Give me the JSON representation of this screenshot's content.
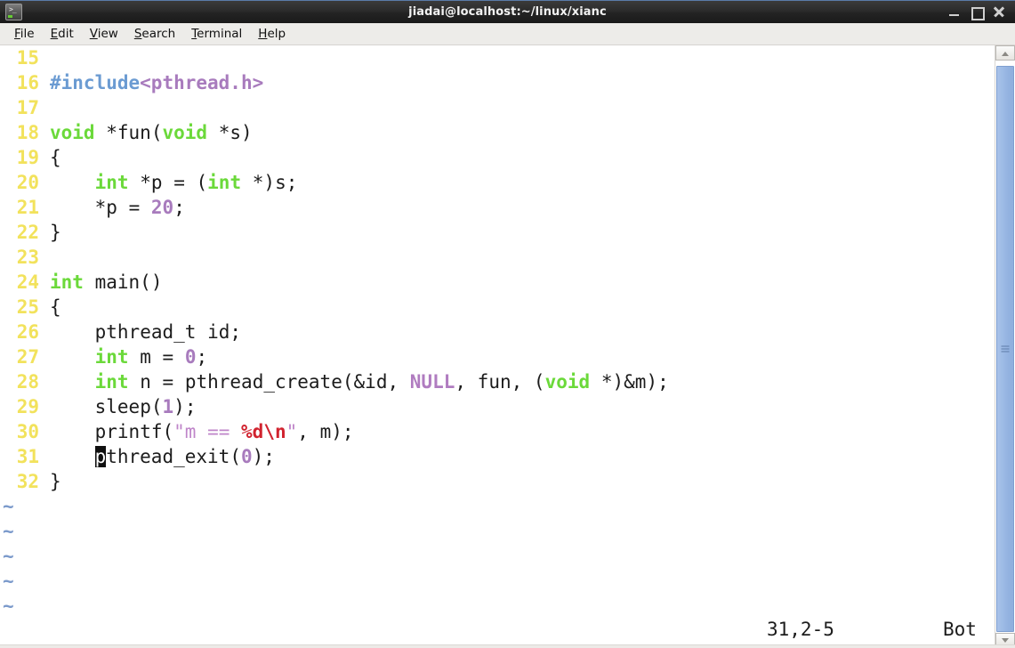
{
  "window": {
    "title": "jiadai@localhost:~/linux/xianc",
    "icon": "terminal-icon",
    "controls": {
      "minimize": "minimize-icon",
      "maximize": "maximize-icon",
      "close": "close-icon"
    }
  },
  "menubar": {
    "items": [
      {
        "label": "File",
        "mnemonic": "F"
      },
      {
        "label": "Edit",
        "mnemonic": "E"
      },
      {
        "label": "View",
        "mnemonic": "V"
      },
      {
        "label": "Search",
        "mnemonic": "S"
      },
      {
        "label": "Terminal",
        "mnemonic": "T"
      },
      {
        "label": "Help",
        "mnemonic": "H"
      }
    ]
  },
  "editor": {
    "lines": [
      {
        "num": "15",
        "text": ""
      },
      {
        "num": "16",
        "text": "#include<pthread.h>"
      },
      {
        "num": "17",
        "text": ""
      },
      {
        "num": "18",
        "text": "void *fun(void *s)"
      },
      {
        "num": "19",
        "text": "{"
      },
      {
        "num": "20",
        "text": "    int *p = (int *)s;"
      },
      {
        "num": "21",
        "text": "    *p = 20;"
      },
      {
        "num": "22",
        "text": "}"
      },
      {
        "num": "23",
        "text": ""
      },
      {
        "num": "24",
        "text": "int main()"
      },
      {
        "num": "25",
        "text": "{"
      },
      {
        "num": "26",
        "text": "    pthread_t id;"
      },
      {
        "num": "27",
        "text": "    int m = 0;"
      },
      {
        "num": "28",
        "text": "    int n = pthread_create(&id, NULL, fun, (void *)&m);"
      },
      {
        "num": "29",
        "text": "    sleep(1);"
      },
      {
        "num": "30",
        "text": "    printf(\"m == %d\\n\", m);"
      },
      {
        "num": "31",
        "text": "    pthread_exit(0);"
      },
      {
        "num": "32",
        "text": "}"
      }
    ],
    "empty_markers": [
      "~",
      "~",
      "~",
      "~",
      "~"
    ],
    "cursor": {
      "char": "p",
      "line": "31",
      "column": "2"
    },
    "colors": {
      "linenumber": "#f2e25c",
      "keyword": "#6bd93a",
      "preprocessor": "#6b9bd2",
      "header": "#a87bbd",
      "number": "#a87bbd",
      "constant": "#b07cc0",
      "string": "#bf85c9",
      "escape": "#d1232f",
      "text": "#1c1c1c",
      "tilde": "#7b9acb",
      "background": "#ffffff"
    }
  },
  "statusline": {
    "position": "31,2-5",
    "location": "Bot"
  },
  "scrollbar": {
    "up_arrow": "scroll-up-icon",
    "down_arrow": "scroll-down-icon",
    "thumb_grip": "scrollbar-grip-icon"
  }
}
